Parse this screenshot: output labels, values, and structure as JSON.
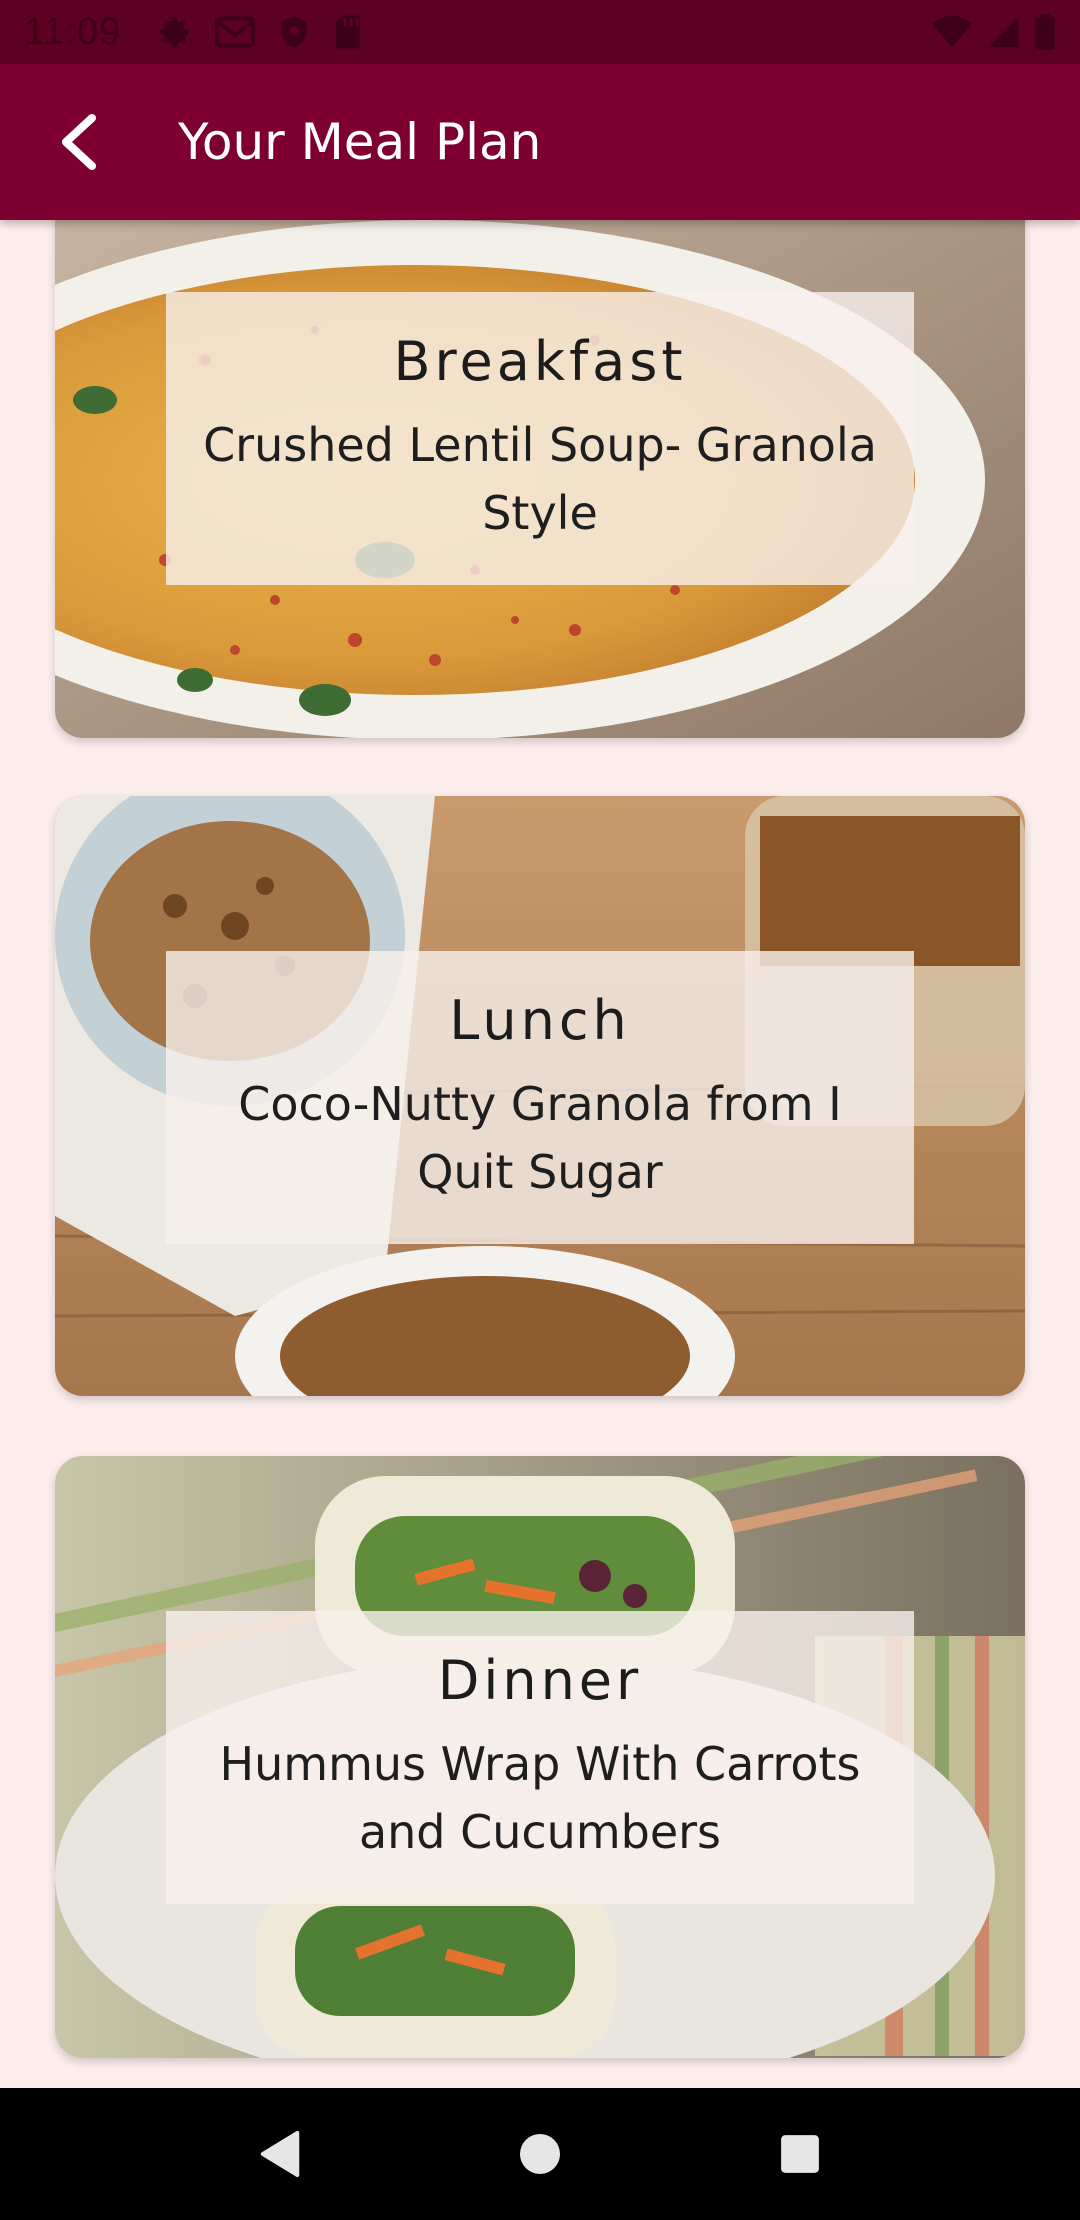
{
  "status_bar": {
    "time": "11:09",
    "icons": [
      "gear-icon",
      "gmail-icon",
      "shield-icon",
      "sd-card-icon"
    ],
    "right_icons": [
      "wifi-icon",
      "signal-icon",
      "battery-icon"
    ]
  },
  "app_bar": {
    "title": "Your Meal Plan",
    "back_icon": "arrow-back-icon"
  },
  "meals": [
    {
      "type": "Breakfast",
      "name": "Crushed Lentil Soup- Granola Style",
      "image": "lentil-soup-photo"
    },
    {
      "type": "Lunch",
      "name": "Coco-Nutty Granola from I Quit Sugar",
      "image": "granola-photo"
    },
    {
      "type": "Dinner",
      "name": "Hummus Wrap With Carrots and Cucumbers",
      "image": "hummus-wrap-photo"
    }
  ],
  "nav_bar": {
    "buttons": [
      "back-triangle-icon",
      "home-circle-icon",
      "recents-square-icon"
    ]
  },
  "colors": {
    "status_bar": "#5e0022",
    "app_bar": "#7d0030",
    "background": "#fdeeed",
    "label_overlay": "#f8f0ec"
  }
}
